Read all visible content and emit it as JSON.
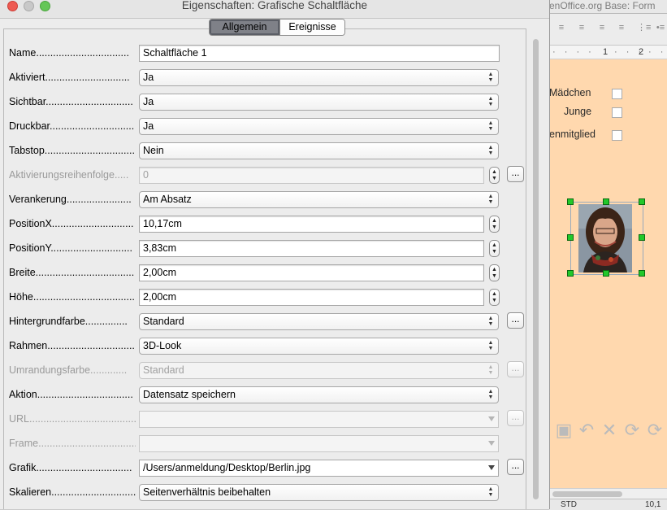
{
  "dialog": {
    "title": "Eigenschaften: Grafische Schaltfläche",
    "tabs": [
      {
        "label": "Allgemein",
        "active": true
      },
      {
        "label": "Ereignisse",
        "active": false
      }
    ],
    "fields": {
      "name": {
        "label": "Name.................................",
        "value": "Schaltfläche 1"
      },
      "aktiviert": {
        "label": "Aktiviert..............................",
        "value": "Ja"
      },
      "sichtbar": {
        "label": "Sichtbar...............................",
        "value": "Ja"
      },
      "druckbar": {
        "label": "Druckbar..............................",
        "value": "Ja"
      },
      "tabstop": {
        "label": "Tabstop................................",
        "value": "Nein"
      },
      "aktivierungsreihenfolge": {
        "label": "Aktivierungsreihenfolge.....",
        "value": "0"
      },
      "verankerung": {
        "label": "Verankerung.......................",
        "value": "Am Absatz"
      },
      "position_x": {
        "label": "PositionX.............................",
        "value": "10,17cm"
      },
      "position_y": {
        "label": "PositionY.............................",
        "value": "3,83cm"
      },
      "breite": {
        "label": "Breite...................................",
        "value": "2,00cm"
      },
      "hoehe": {
        "label": "Höhe.....................................",
        "value": "2,00cm"
      },
      "hintergrundfarbe": {
        "label": "Hintergrundfarbe...............",
        "value": "Standard"
      },
      "rahmen": {
        "label": "Rahmen...............................",
        "value": "3D-Look"
      },
      "umrandungsfarbe": {
        "label": "Umrandungsfarbe.............",
        "value": "Standard"
      },
      "aktion": {
        "label": "Aktion..................................",
        "value": "Datensatz speichern"
      },
      "url": {
        "label": "URL.......................................",
        "value": ""
      },
      "frame": {
        "label": "Frame...................................",
        "value": ""
      },
      "grafik": {
        "label": "Grafik..................................",
        "value": "/Users/anmeldung/Desktop/Berlin.jpg"
      },
      "skalieren": {
        "label": "Skalieren..............................",
        "value": "Seitenverhältnis beibehalten"
      }
    },
    "dots_label": "..."
  },
  "background_app": {
    "title_fragment": "enOffice.org Base: Form",
    "ruler_ticks": [
      "1",
      "2"
    ],
    "checkbox_labels": [
      "Mädchen",
      "Junge",
      "enmitglied"
    ],
    "status_fragments": [
      "STD",
      "10,1"
    ]
  },
  "colors": {
    "form_background": "#ffd8ae",
    "dialog_background": "#ececec",
    "active_tab": "#7f8188",
    "selection_handle": "#22c82a"
  }
}
